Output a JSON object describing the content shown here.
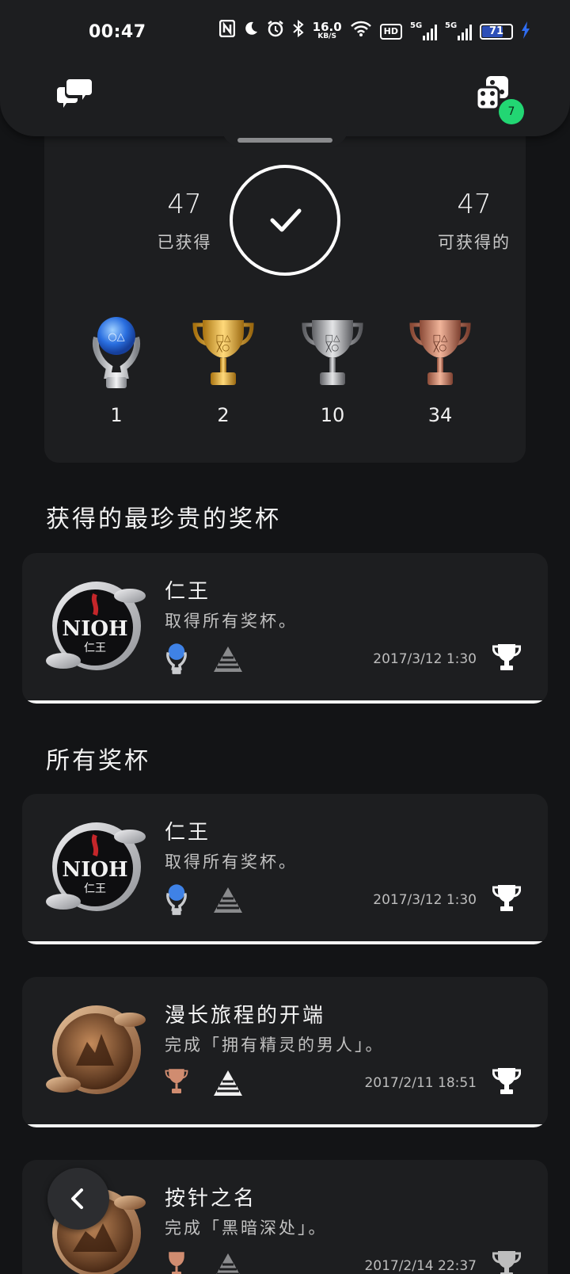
{
  "status_bar": {
    "time": "00:47",
    "net_speed_value": "16.0",
    "net_speed_unit": "KB/S",
    "hd_label": "HD",
    "signal_1_label": "5G",
    "signal_2_label": "5G",
    "battery_level": "71"
  },
  "header": {
    "chat_icon": "chat-bubbles-icon",
    "dice_icon": "dice-icon",
    "notification_count": "7"
  },
  "summary": {
    "earned_count": "47",
    "earned_label": "已获得",
    "available_count": "47",
    "available_label": "可获得的",
    "trophies": [
      {
        "type": "platinum",
        "count": "1"
      },
      {
        "type": "gold",
        "count": "2"
      },
      {
        "type": "silver",
        "count": "10"
      },
      {
        "type": "bronze",
        "count": "34"
      }
    ]
  },
  "sections": {
    "rarest_title": "获得的最珍贵的奖杯",
    "all_title": "所有奖杯"
  },
  "rarest": [
    {
      "name": "仁王",
      "description": "取得所有奖杯。",
      "grade": "platinum",
      "date": "2017/3/12  1:30",
      "game_icon_text": "NIOH",
      "game_icon_sub": "仁王"
    }
  ],
  "all_trophies": [
    {
      "name": "仁王",
      "description": "取得所有奖杯。",
      "grade": "platinum",
      "date": "2017/3/12  1:30",
      "game_icon_text": "NIOH",
      "game_icon_sub": "仁王"
    },
    {
      "name": "漫长旅程的开端",
      "description": "完成「拥有精灵的男人」。",
      "grade": "bronze",
      "date": "2017/2/11  18:51"
    },
    {
      "name": "按针之名",
      "description": "完成「黑暗深处」。",
      "grade": "bronze",
      "date": "2017/2/14  22:37"
    }
  ],
  "colors": {
    "background": "#131416",
    "card": "#1d1e20",
    "badge": "#22d673",
    "platinum": "#4a8be0",
    "gold": "#d4a02a",
    "silver": "#a9a9ab",
    "bronze": "#c27a5e"
  }
}
